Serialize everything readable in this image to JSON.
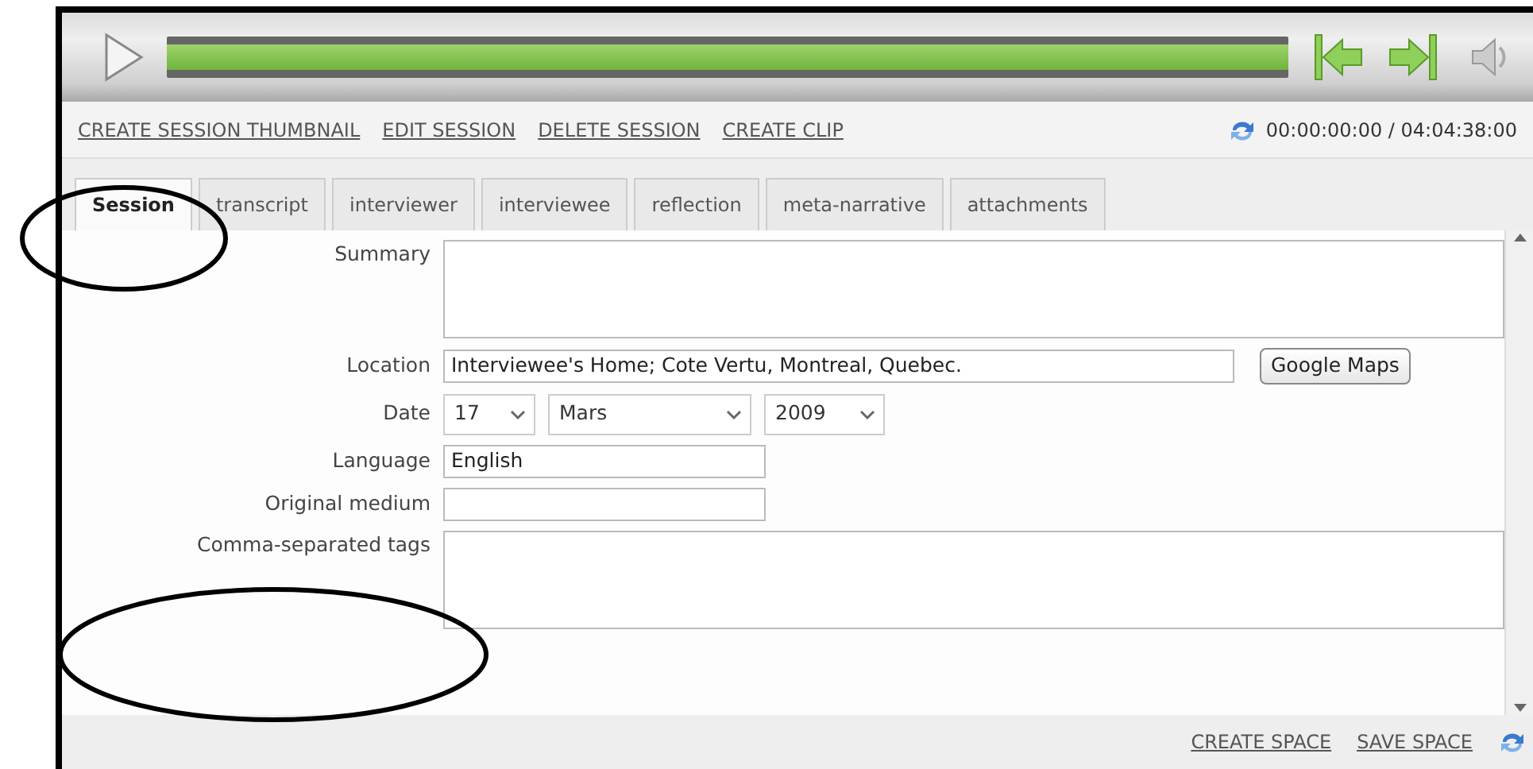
{
  "player": {
    "level": 1
  },
  "actions": [
    "CREATE SESSION THUMBNAIL",
    "EDIT SESSION",
    "DELETE SESSION",
    "CREATE CLIP"
  ],
  "timecode": "00:00:00:00 / 04:04:38:00",
  "tabs": [
    {
      "label": "Session",
      "selected": true
    },
    {
      "label": "transcript",
      "selected": false
    },
    {
      "label": "interviewer",
      "selected": false
    },
    {
      "label": "interviewee",
      "selected": false
    },
    {
      "label": "reflection",
      "selected": false
    },
    {
      "label": "meta-narrative",
      "selected": false
    },
    {
      "label": "attachments",
      "selected": false
    }
  ],
  "fields": [
    {
      "kind": "textarea",
      "label": "Summary"
    },
    {
      "kind": "location",
      "label": "Location",
      "value": "Interviewee's Home; Cote Vertu, Montreal, Quebec.",
      "button": "Google Maps"
    },
    {
      "kind": "date",
      "label": "Date",
      "day": "17",
      "month": "Mars",
      "year": "2009"
    },
    {
      "kind": "text",
      "label": "Language",
      "value": "English"
    },
    {
      "kind": "text",
      "label": "Original medium"
    },
    {
      "kind": "textarea",
      "label": "Comma-separated tags"
    }
  ],
  "footer_actions": [
    "CREATE SPACE",
    "SAVE SPACE"
  ],
  "annotations": [
    {
      "kind": "ellipse"
    },
    {
      "kind": "ellipse"
    }
  ]
}
